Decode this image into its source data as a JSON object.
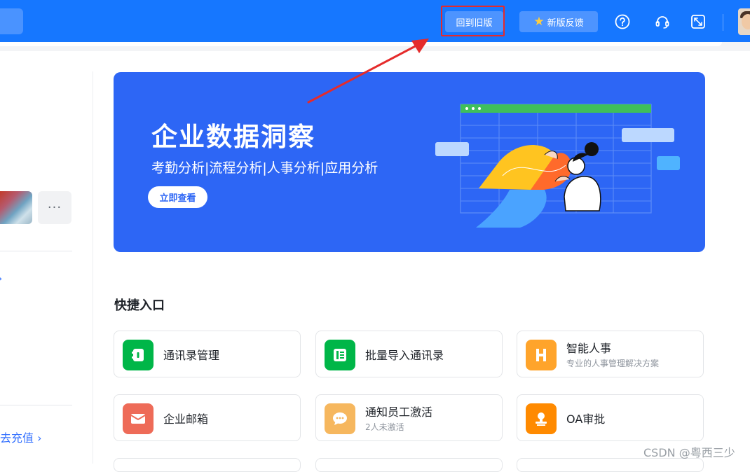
{
  "header": {
    "old_version_label": "回到旧版",
    "feedback_label": "新版反馈",
    "icons": [
      "help-icon",
      "support-icon",
      "fullscreen-icon"
    ]
  },
  "left": {
    "more_label": "···",
    "arrow_glyph": "›",
    "recharge_label": "去充值 ›"
  },
  "banner": {
    "title": "企业数据洞察",
    "subtitle": "考勤分析|流程分析|人事分析|应用分析",
    "button_label": "立即查看"
  },
  "quick": {
    "title": "快捷入口",
    "items": [
      {
        "name": "通讯录管理",
        "desc": "",
        "icon": "contacts-book-icon",
        "color": "#00b648"
      },
      {
        "name": "批量导入通讯录",
        "desc": "",
        "icon": "import-contacts-icon",
        "color": "#00b648"
      },
      {
        "name": "智能人事",
        "desc": "专业的人事管理解决方案",
        "icon": "hr-icon",
        "color": "#ffa42b"
      },
      {
        "name": "企业邮箱",
        "desc": "",
        "icon": "mail-icon",
        "color": "#ee6b58"
      },
      {
        "name": "通知员工激活",
        "desc": "2人未激活",
        "icon": "chat-bubble-icon",
        "color": "#f6b75e"
      },
      {
        "name": "OA审批",
        "desc": "",
        "icon": "stamp-icon",
        "color": "#ff8a00"
      }
    ]
  },
  "colors": {
    "topbar": "#1677ff",
    "banner": "#2d66f5",
    "annotation_red": "#e52b2b",
    "link_blue": "#3370ff"
  },
  "watermark": "CSDN @粤西三少"
}
